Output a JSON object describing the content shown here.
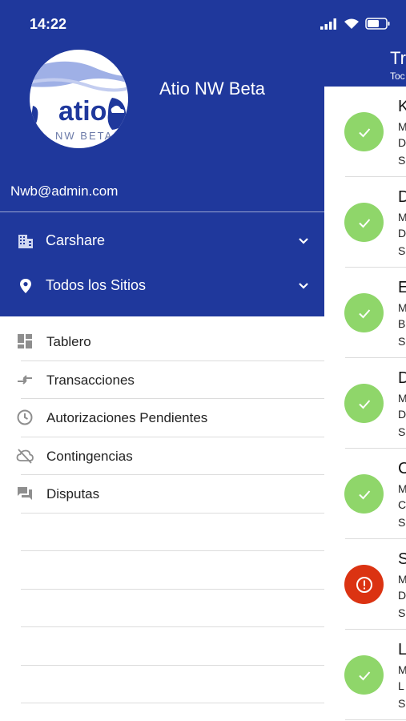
{
  "status_bar": {
    "time": "14:22"
  },
  "app": {
    "name": "Atio NW Beta",
    "logo_word": "atio",
    "logo_sub": "NW BETA",
    "user_email": "Nwb@admin.com",
    "brand_color": "#1f389c"
  },
  "selectors": [
    {
      "label": "Carshare",
      "icon": "building-icon"
    },
    {
      "label": "Todos los Sitios",
      "icon": "location-pin-icon"
    }
  ],
  "menu": [
    {
      "label": "Tablero",
      "icon": "dashboard-icon"
    },
    {
      "label": "Transacciones",
      "icon": "transactions-icon"
    },
    {
      "label": "Autorizaciones Pendientes",
      "icon": "clock-icon"
    },
    {
      "label": "Contingencias",
      "icon": "cloud-off-icon"
    },
    {
      "label": "Disputas",
      "icon": "chat-icon"
    }
  ],
  "background": {
    "header_title": "Tr",
    "header_sub": "Toc",
    "items": [
      {
        "status": "ok",
        "t1": "K",
        "l1": "M",
        "l2": "D",
        "l3": "S"
      },
      {
        "status": "ok",
        "t1": "D",
        "l1": "M",
        "l2": "D",
        "l3": "S"
      },
      {
        "status": "ok",
        "t1": "E",
        "l1": "M",
        "l2": "B",
        "l3": "S"
      },
      {
        "status": "ok",
        "t1": "D",
        "l1": "M",
        "l2": "D",
        "l3": "S"
      },
      {
        "status": "ok",
        "t1": "C",
        "l1": "M",
        "l2": "C",
        "l3": "S"
      },
      {
        "status": "error",
        "t1": "S",
        "l1": "M",
        "l2": "D",
        "l3": "S"
      },
      {
        "status": "ok",
        "t1": "L",
        "l1": "M",
        "l2": "L",
        "l3": "S"
      }
    ]
  }
}
